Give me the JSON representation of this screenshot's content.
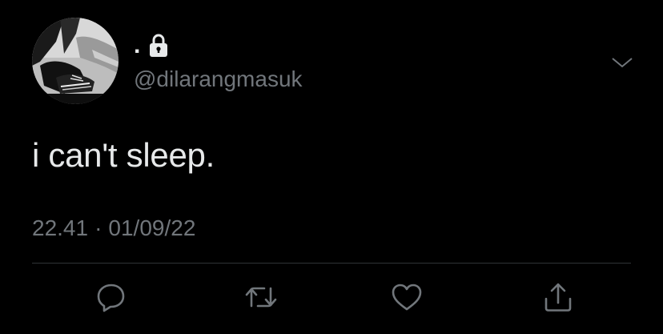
{
  "tweet": {
    "display_name": ".",
    "handle": "@dilarangmasuk",
    "text": "i can't sleep.",
    "time": "22.41",
    "separator": "·",
    "date": "01/09/22"
  },
  "icons": {
    "lock": "lock-icon",
    "caret": "chevron-down-icon",
    "reply": "reply-icon",
    "retweet": "retweet-icon",
    "like": "heart-icon",
    "share": "share-icon"
  },
  "colors": {
    "background": "#000000",
    "primary_text": "#e7e9ea",
    "secondary_text": "#71767b",
    "divider": "#2f3336"
  }
}
